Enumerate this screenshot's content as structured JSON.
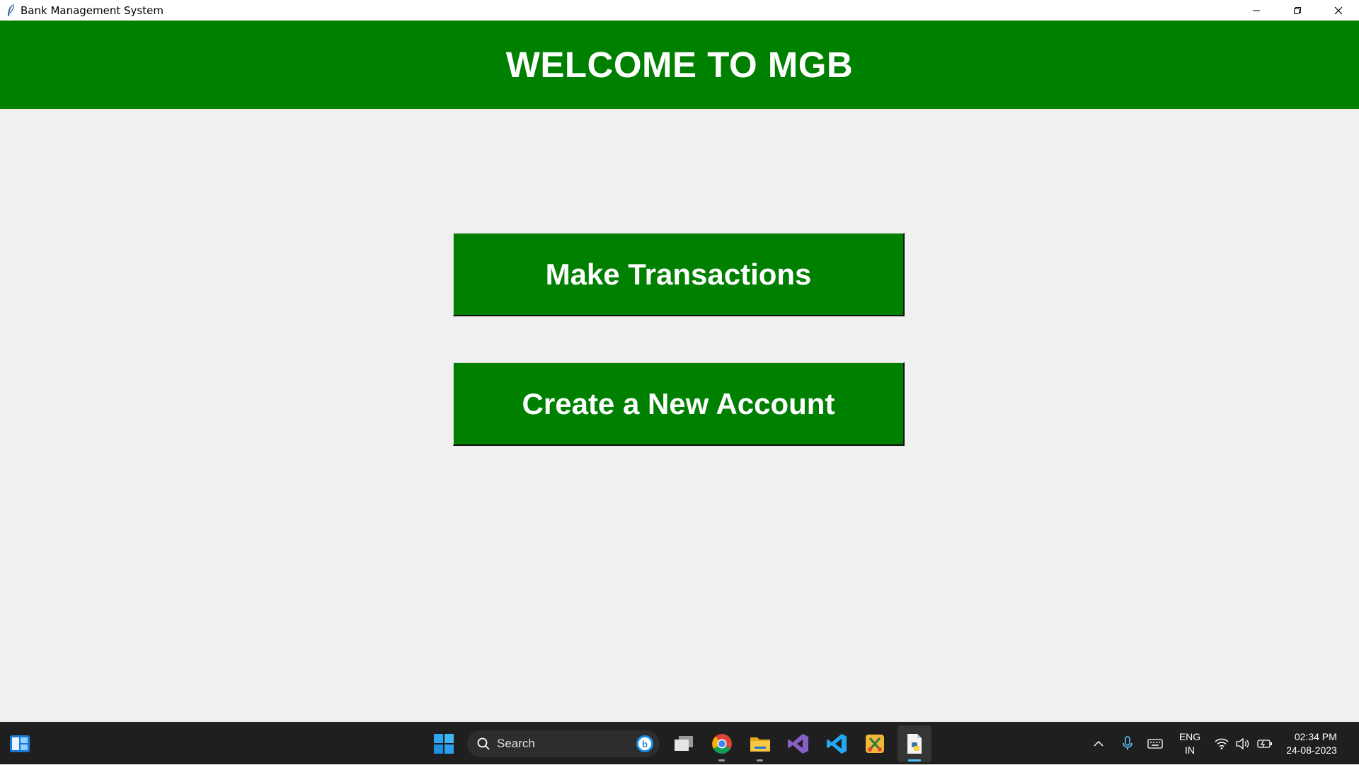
{
  "window": {
    "title": "Bank Management System"
  },
  "header": {
    "title": "WELCOME TO MGB"
  },
  "buttons": {
    "make_transactions": "Make Transactions",
    "create_account": "Create a New Account"
  },
  "colors": {
    "primary_green": "#008000",
    "background": "#f0f0f0",
    "taskbar": "#1f1f1f"
  },
  "taskbar": {
    "search_placeholder": "Search",
    "language": "ENG",
    "region": "IN",
    "time": "02:34 PM",
    "date": "24-08-2023",
    "apps": [
      "widgets-icon",
      "start-icon",
      "task-view-icon",
      "chrome-icon",
      "file-explorer-icon",
      "visual-studio-icon",
      "vscode-icon",
      "snipping-tool-icon",
      "python-idle-icon"
    ]
  }
}
